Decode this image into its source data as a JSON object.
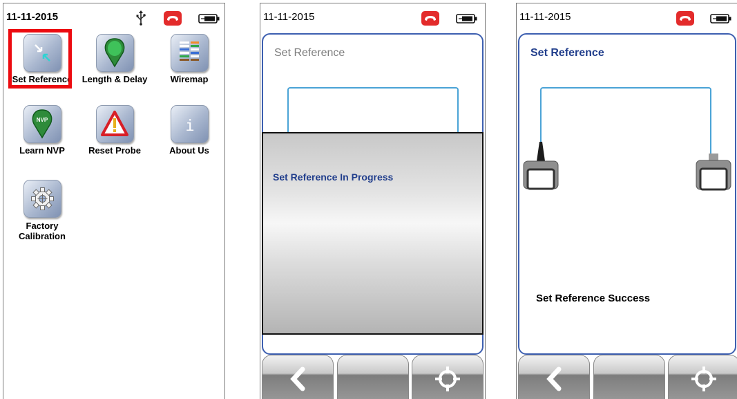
{
  "screen1": {
    "date": "11-11-2015",
    "apps": [
      {
        "label": "Set Reference",
        "icon": "set-reference-icon"
      },
      {
        "label": "Length & Delay",
        "icon": "length-delay-icon"
      },
      {
        "label": "Wiremap",
        "icon": "wiremap-icon"
      },
      {
        "label": "Learn NVP",
        "icon": "nvp-icon"
      },
      {
        "label": "Reset Probe",
        "icon": "warning-triangle-icon"
      },
      {
        "label": "About Us",
        "icon": "info-icon"
      },
      {
        "label_line1": "Factory",
        "label_line2": "Calibration",
        "icon": "gear-icon"
      }
    ]
  },
  "screen2": {
    "date": "11-11-2015",
    "title": "Set Reference",
    "overlay_message": "Set Reference In Progress"
  },
  "screen3": {
    "date": "11-11-2015",
    "title": "Set Reference",
    "result_message": "Set Reference Success"
  },
  "colors": {
    "highlight": "#ec0b10",
    "title_blue": "#213e8c",
    "panel_border": "#3d5fb0",
    "cable": "#4aa3d6",
    "phone_red": "#e32b2b"
  },
  "toolbar_icons": [
    "back-chevron-icon",
    "blank-button",
    "crosshair-icon"
  ]
}
